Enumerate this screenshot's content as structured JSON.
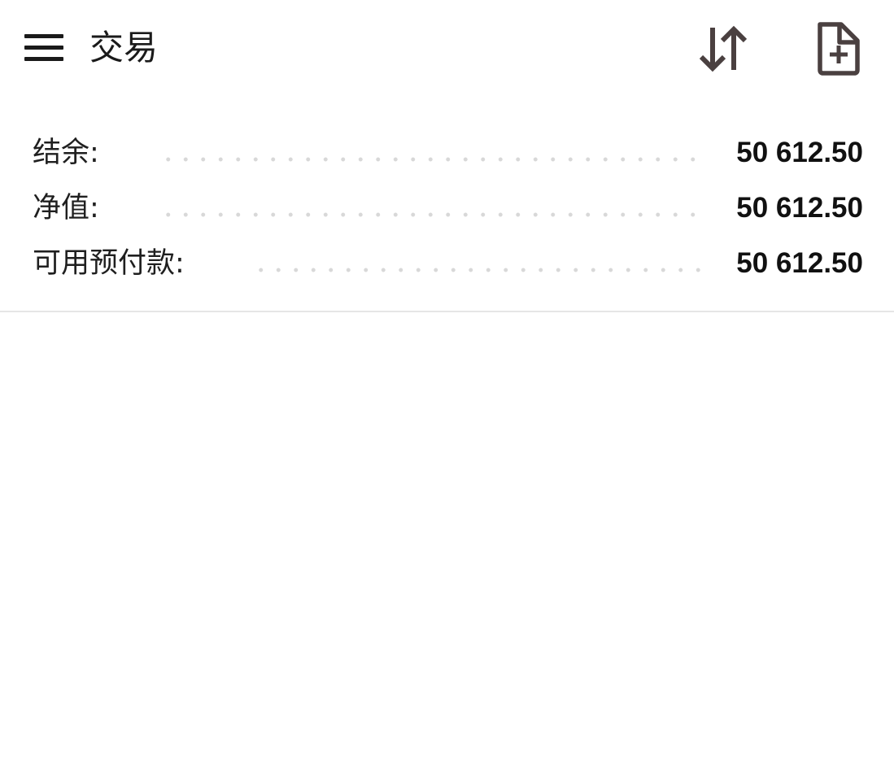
{
  "header": {
    "title": "交易",
    "icons": {
      "menu": "hamburger-menu-icon",
      "sort": "sort-arrows-icon",
      "new_document": "new-document-icon"
    },
    "icon_color": "#4a4040"
  },
  "summary": {
    "rows": [
      {
        "label": "结余:",
        "value": "50 612.50"
      },
      {
        "label": "净值:",
        "value": "50 612.50"
      },
      {
        "label": "可用预付款:",
        "value": "50 612.50"
      }
    ]
  }
}
